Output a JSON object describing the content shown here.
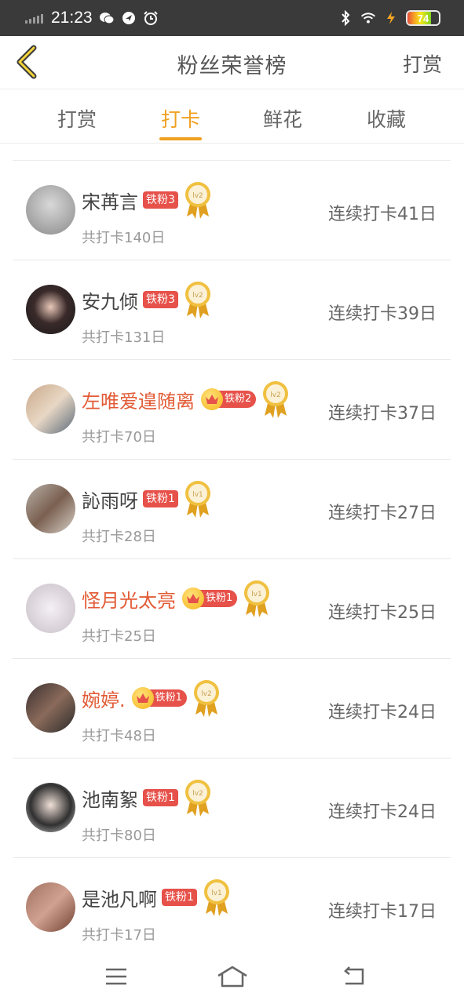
{
  "status_bar": {
    "time": "21:23",
    "battery_level": "74",
    "icons": [
      "signal-icon",
      "wechat-icon",
      "location-icon",
      "alarm-icon",
      "bluetooth-icon",
      "wifi-icon",
      "charging-icon",
      "battery-icon"
    ]
  },
  "header": {
    "title": "粉丝荣誉榜",
    "action_label": "打赏",
    "back_icon": "back-arrow-icon"
  },
  "tabs": {
    "items": [
      {
        "label": "打赏",
        "active": false
      },
      {
        "label": "打卡",
        "active": true
      },
      {
        "label": "鲜花",
        "active": false
      },
      {
        "label": "收藏",
        "active": false
      }
    ]
  },
  "colors": {
    "accent": "#f0a020",
    "highlight_name": "#e25b36",
    "badge_red": "#e6514a"
  },
  "rows": [
    {
      "name": "宋苒言",
      "name_red": false,
      "crown": false,
      "fan_badge": "铁粉3",
      "medal": "lv2",
      "total": "共打卡140日",
      "streak": "连续打卡41日"
    },
    {
      "name": "安九倾",
      "name_red": false,
      "crown": false,
      "fan_badge": "铁粉3",
      "medal": "lv2",
      "total": "共打卡131日",
      "streak": "连续打卡39日"
    },
    {
      "name": "左唯爱遑随离",
      "name_red": true,
      "crown": true,
      "fan_badge": "铁粉2",
      "medal": "lv2",
      "total": "共打卡70日",
      "streak": "连续打卡37日"
    },
    {
      "name": "訫雨呀",
      "name_red": false,
      "crown": false,
      "fan_badge": "铁粉1",
      "medal": "lv1",
      "total": "共打卡28日",
      "streak": "连续打卡27日"
    },
    {
      "name": "怪月光太亮",
      "name_red": true,
      "crown": true,
      "fan_badge": "铁粉1",
      "medal": "lv1",
      "total": "共打卡25日",
      "streak": "连续打卡25日"
    },
    {
      "name": "婉婷.",
      "name_red": true,
      "crown": true,
      "fan_badge": "铁粉1",
      "medal": "lv2",
      "total": "共打卡48日",
      "streak": "连续打卡24日"
    },
    {
      "name": "池南絮",
      "name_red": false,
      "crown": false,
      "fan_badge": "铁粉1",
      "medal": "lv2",
      "total": "共打卡80日",
      "streak": "连续打卡24日"
    },
    {
      "name": "是池凡啊",
      "name_red": false,
      "crown": false,
      "fan_badge": "铁粉1",
      "medal": "lv1",
      "total": "共打卡17日",
      "streak": "连续打卡17日"
    }
  ],
  "navbar": {
    "icons": [
      "menu-icon",
      "home-icon",
      "back-icon"
    ]
  }
}
